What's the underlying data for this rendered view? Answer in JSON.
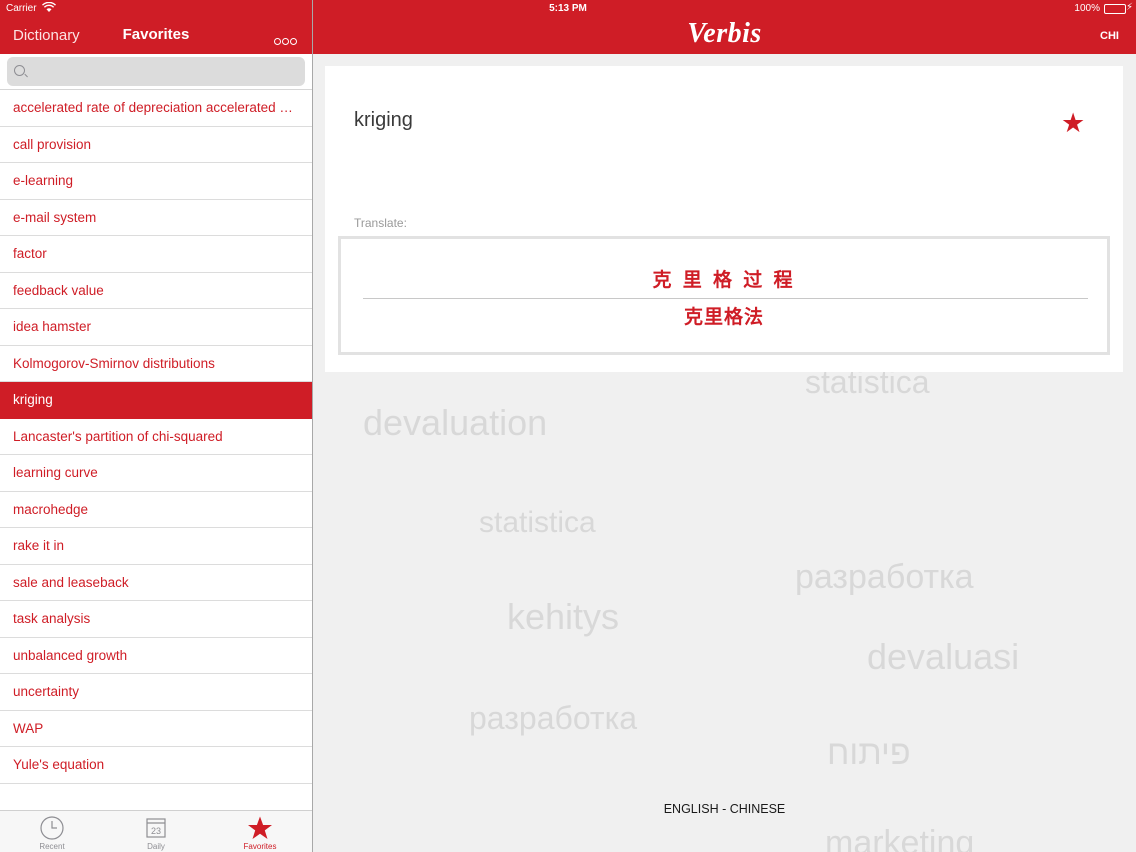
{
  "status_bar": {
    "carrier": "Carrier",
    "time": "5:13 PM",
    "battery": "100%"
  },
  "nav": {
    "dictionary_label": "Dictionary",
    "favorites_title": "Favorites"
  },
  "brand": "Verbis",
  "language_button": "CHI",
  "search": {
    "placeholder": ""
  },
  "favorites": [
    "accelerated rate of depreciation accelerated depreciation",
    "call provision",
    "e-learning",
    "e-mail system",
    "factor",
    "feedback value",
    "idea hamster",
    "Kolmogorov-Smirnov distributions",
    "kriging",
    "Lancaster's partition of chi-squared",
    "learning curve",
    "macrohedge",
    "rake it in",
    "sale and leaseback",
    "task analysis",
    "unbalanced growth",
    "uncertainty",
    "WAP",
    "Yule's equation"
  ],
  "selected_index": 8,
  "tabs": [
    {
      "label": "Recent",
      "icon": "clock-icon"
    },
    {
      "label": "Daily",
      "icon": "calendar-icon",
      "day": "23"
    },
    {
      "label": "Favorites",
      "icon": "star-icon"
    }
  ],
  "entry": {
    "term": "kriging",
    "translate_label": "Translate:",
    "translations": [
      "克 里 格 过 程",
      "克里格法"
    ]
  },
  "language_pair": "ENGLISH - CHINESE",
  "background_words": [
    "statistica",
    "devaluation",
    "разработка",
    "kehitys",
    "devaluasi",
    "פיתוח",
    "marketing",
    "statistica",
    "разработка"
  ],
  "colors": {
    "accent": "#cf1d26",
    "battery": "#4cd964"
  }
}
